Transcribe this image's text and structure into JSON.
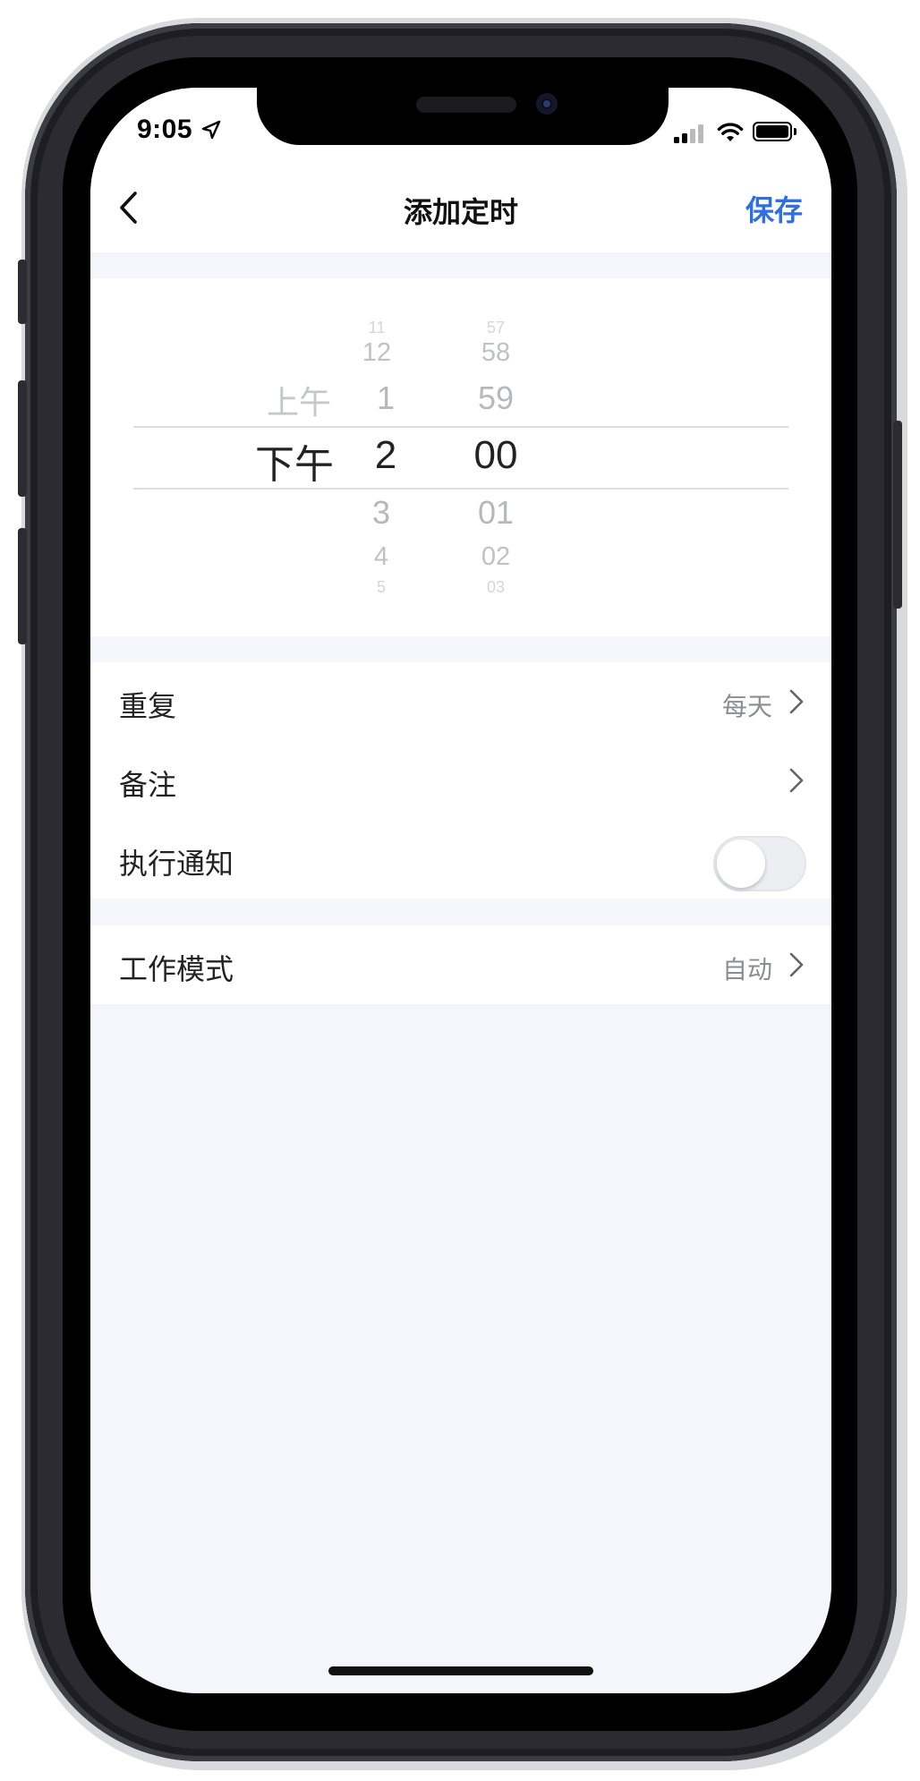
{
  "status_bar": {
    "time": "9:05",
    "location_icon": "location-arrow-icon",
    "signal_icon": "cellular-signal-icon",
    "wifi_icon": "wifi-icon",
    "battery_icon": "battery-full-icon"
  },
  "nav": {
    "back_icon": "chevron-left-icon",
    "title": "添加定时",
    "save_label": "保存",
    "accent_color": "#2f6fe0"
  },
  "time_picker": {
    "ampm": {
      "above": "上午",
      "selected": "下午"
    },
    "hour": {
      "above3": "11",
      "above2": "12",
      "above1": "1",
      "selected": "2",
      "below1": "3",
      "below2": "4",
      "below3": "5"
    },
    "minute": {
      "above3": "57",
      "above2": "58",
      "above1": "59",
      "selected": "00",
      "below1": "01",
      "below2": "02",
      "below3": "03"
    }
  },
  "settings": {
    "repeat": {
      "label": "重复",
      "value": "每天"
    },
    "note": {
      "label": "备注"
    },
    "notify": {
      "label": "执行通知",
      "enabled": false
    },
    "work_mode": {
      "label": "工作模式",
      "value": "自动"
    }
  }
}
